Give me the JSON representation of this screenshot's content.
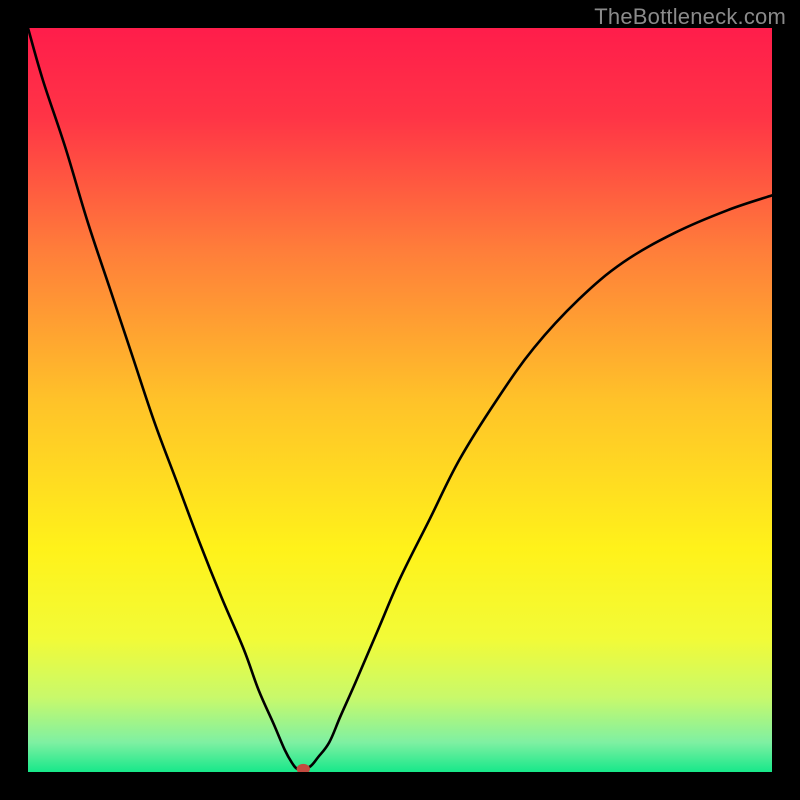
{
  "watermark": "TheBottleneck.com",
  "chart_data": {
    "type": "line",
    "title": "",
    "xlabel": "",
    "ylabel": "",
    "xlim": [
      0,
      100
    ],
    "ylim": [
      0,
      100
    ],
    "grid": false,
    "legend": false,
    "background_gradient_stops": [
      {
        "offset": 0.0,
        "color": "#ff1d4b"
      },
      {
        "offset": 0.12,
        "color": "#ff3446"
      },
      {
        "offset": 0.3,
        "color": "#ff7e3a"
      },
      {
        "offset": 0.5,
        "color": "#ffc229"
      },
      {
        "offset": 0.7,
        "color": "#fff21a"
      },
      {
        "offset": 0.82,
        "color": "#f2fb37"
      },
      {
        "offset": 0.9,
        "color": "#c8f96b"
      },
      {
        "offset": 0.96,
        "color": "#7ff0a2"
      },
      {
        "offset": 1.0,
        "color": "#17e88a"
      }
    ],
    "series": [
      {
        "name": "bottleneck-curve",
        "color": "#000000",
        "x": [
          0,
          2,
          5,
          8,
          11,
          14,
          17,
          20,
          23,
          26,
          29,
          31,
          33,
          34.5,
          35.5,
          36.2,
          37,
          38,
          39,
          40.5,
          42,
          44,
          47,
          50,
          54,
          58,
          63,
          68,
          74,
          80,
          87,
          94,
          100
        ],
        "y": [
          100,
          93,
          84,
          74,
          65,
          56,
          47,
          39,
          31,
          23.5,
          16.5,
          11,
          6.5,
          3,
          1.2,
          0.4,
          0.4,
          0.8,
          2,
          4,
          7.5,
          12,
          19,
          26,
          34,
          42,
          50,
          57,
          63.5,
          68.5,
          72.5,
          75.5,
          77.5
        ]
      }
    ],
    "markers": [
      {
        "name": "optimal-point",
        "x": 37,
        "y": 0.4,
        "rx": 0.9,
        "ry": 0.7,
        "color": "#c24a3f"
      }
    ]
  }
}
